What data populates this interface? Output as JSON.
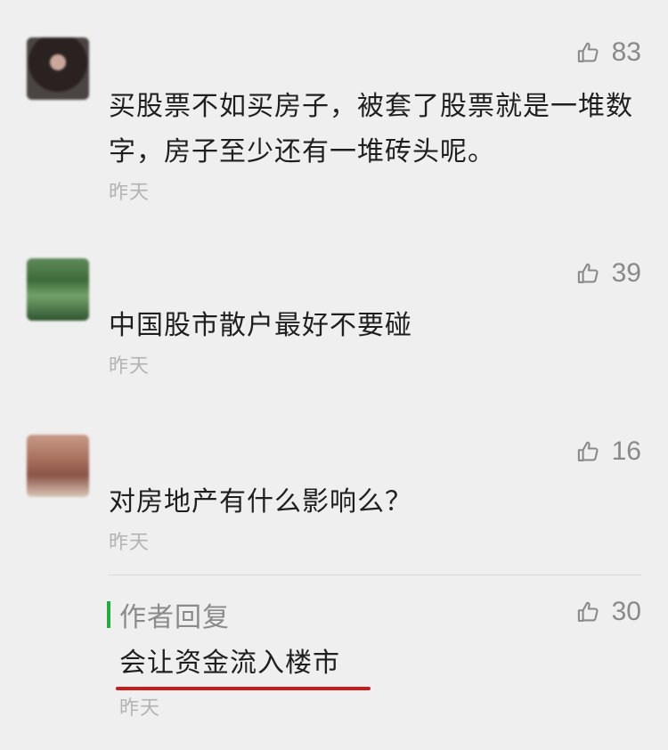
{
  "comments": [
    {
      "text": "买股票不如买房子，被套了股票就是一堆数字，房子至少还有一堆砖头呢。",
      "time": "昨天",
      "likes": "83"
    },
    {
      "text": "中国股市散户最好不要碰",
      "time": "昨天",
      "likes": "39"
    },
    {
      "text": "对房地产有什么影响么？",
      "time": "昨天",
      "likes": "16"
    }
  ],
  "author_reply": {
    "label": "作者回复",
    "text": "会让资金流入楼市",
    "time": "昨天",
    "likes": "30"
  },
  "colors": {
    "background": "#efefef",
    "reply_bar": "#20b03a",
    "highlight_underline": "#c61d1d",
    "muted": "#8a8a8a"
  },
  "icons": {
    "like": "thumbs-up-icon"
  }
}
